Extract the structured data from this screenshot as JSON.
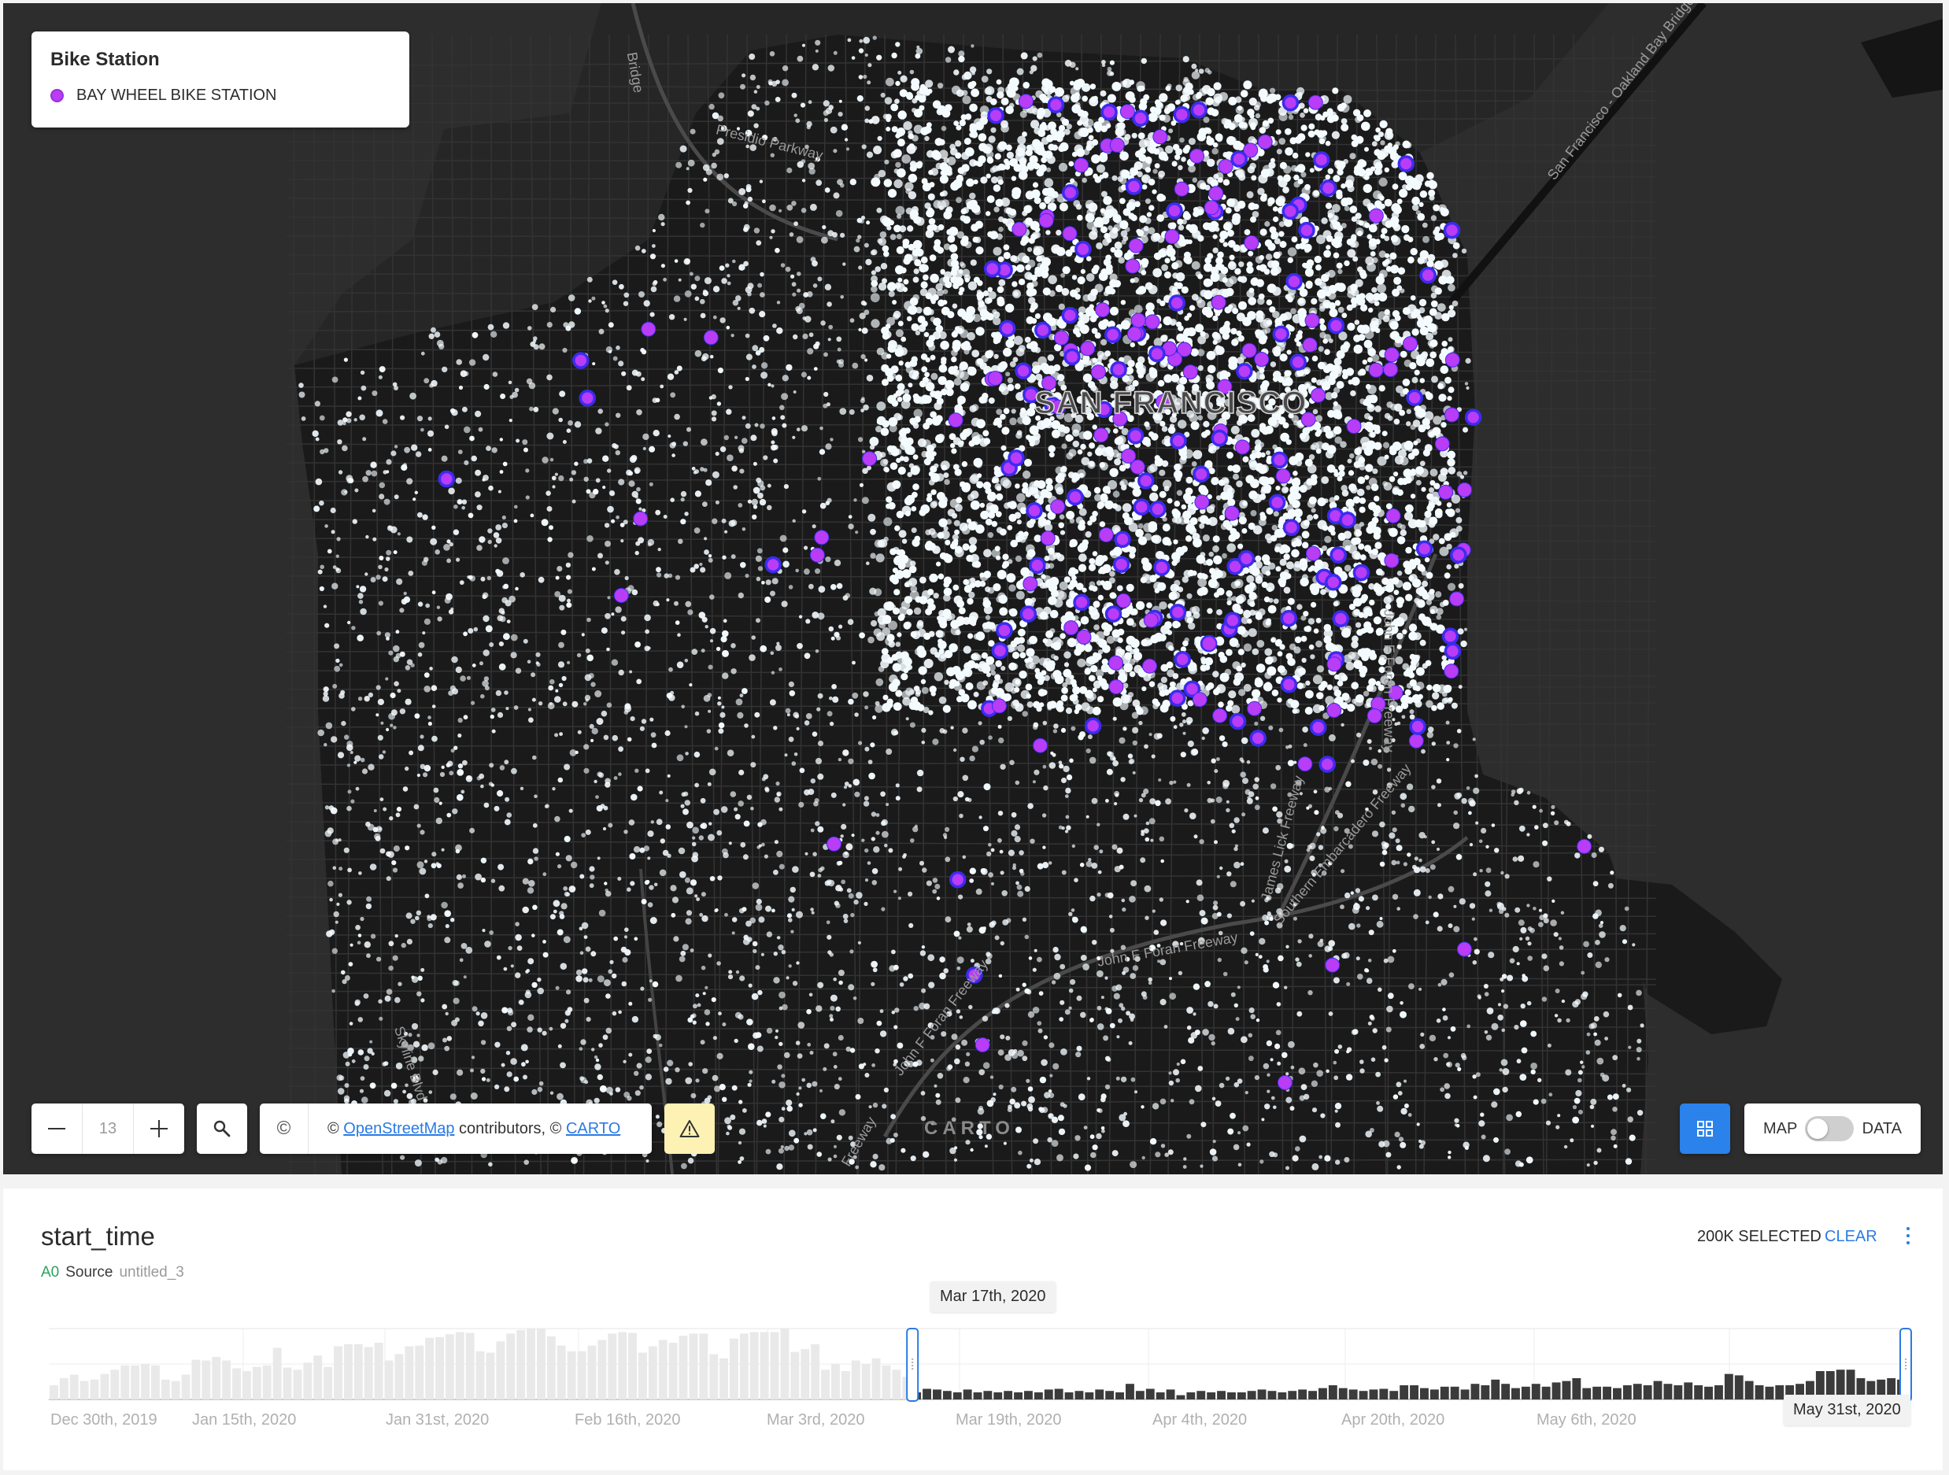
{
  "legend": {
    "title": "Bike Station",
    "item_label": "BAY WHEEL BIKE STATION",
    "item_color": "#b93cf6"
  },
  "map": {
    "city_label": "SAN FRANCISCO",
    "road_labels": [
      "Presidio Parkway",
      "San Francisco - Oakland Bay Bridge",
      "Bridge",
      "James Lick Freeway",
      "John F Foran Freeway",
      "Southern Embarcadero Freeway",
      "John F Foran Freeway",
      "Skyline Blvd",
      "John F Foran Freeway",
      "Freeway"
    ],
    "background_color": "#262626",
    "trip_point_color": "#f4fbff",
    "station_stroke_color": "#3a2cf0"
  },
  "controls": {
    "zoom_out_icon": "minus-icon",
    "zoom_level": "13",
    "zoom_in_icon": "plus-icon",
    "search_icon": "search-icon",
    "copyright_symbol": "©",
    "attribution_prefix": "© ",
    "attribution_link_1": "OpenStreetMap",
    "attribution_middle": " contributors, © ",
    "attribution_link_2": "CARTO",
    "warning_icon": "warning-icon",
    "logo_text": "CARTO",
    "layers_icon": "layers-icon",
    "view_map_label": "MAP",
    "view_data_label": "DATA"
  },
  "widget": {
    "title": "start_time",
    "source_id": "A0",
    "source_label": "Source",
    "source_name": "untitled_3",
    "selected_text": "200K SELECTED",
    "clear_label": "CLEAR",
    "more_icon": "more-vertical-icon",
    "range_start_label": "Mar 17th, 2020",
    "range_end_label": "May 31st, 2020"
  },
  "chart_data": {
    "type": "bar",
    "title": "start_time",
    "x_tick_labels": [
      "Dec 30th, 2019",
      "Jan 15th, 2020",
      "Jan 31st, 2020",
      "Feb 16th, 2020",
      "Mar 3rd, 2020",
      "Mar 19th, 2020",
      "Apr 4th, 2020",
      "Apr 20th, 2020",
      "May 6th, 2020"
    ],
    "selected_range": [
      "Mar 17th, 2020",
      "May 31st, 2020"
    ],
    "selected_color": "#3b3b3b",
    "unselected_color": "#e9e9e9",
    "values_relative": [
      0.2,
      0.3,
      0.35,
      0.26,
      0.28,
      0.36,
      0.42,
      0.48,
      0.48,
      0.5,
      0.48,
      0.28,
      0.26,
      0.35,
      0.56,
      0.55,
      0.6,
      0.55,
      0.44,
      0.4,
      0.46,
      0.48,
      0.73,
      0.45,
      0.42,
      0.52,
      0.62,
      0.46,
      0.75,
      0.78,
      0.78,
      0.74,
      0.8,
      0.55,
      0.64,
      0.75,
      0.76,
      0.87,
      0.88,
      0.92,
      0.95,
      0.94,
      0.68,
      0.66,
      0.82,
      0.93,
      0.98,
      1.0,
      1.0,
      0.89,
      0.76,
      0.68,
      0.68,
      0.76,
      0.84,
      0.93,
      0.95,
      0.94,
      0.66,
      0.75,
      0.84,
      0.8,
      0.9,
      0.93,
      0.93,
      0.64,
      0.58,
      0.86,
      0.93,
      0.95,
      0.95,
      0.95,
      1.0,
      0.67,
      0.71,
      0.78,
      0.42,
      0.5,
      0.4,
      0.55,
      0.5,
      0.58,
      0.48,
      0.42,
      0.32,
      0.1,
      0.15,
      0.14,
      0.12,
      0.1,
      0.14,
      0.1,
      0.12,
      0.1,
      0.12,
      0.1,
      0.12,
      0.1,
      0.14,
      0.15,
      0.1,
      0.12,
      0.1,
      0.14,
      0.12,
      0.1,
      0.22,
      0.12,
      0.15,
      0.1,
      0.14,
      0.06,
      0.1,
      0.12,
      0.1,
      0.12,
      0.1,
      0.1,
      0.12,
      0.14,
      0.12,
      0.1,
      0.12,
      0.14,
      0.12,
      0.16,
      0.2,
      0.16,
      0.14,
      0.12,
      0.14,
      0.15,
      0.12,
      0.2,
      0.2,
      0.16,
      0.14,
      0.18,
      0.18,
      0.14,
      0.22,
      0.2,
      0.28,
      0.22,
      0.16,
      0.18,
      0.22,
      0.18,
      0.24,
      0.26,
      0.3,
      0.16,
      0.18,
      0.18,
      0.16,
      0.2,
      0.22,
      0.2,
      0.26,
      0.22,
      0.2,
      0.24,
      0.2,
      0.18,
      0.2,
      0.36,
      0.34,
      0.26,
      0.2,
      0.18,
      0.2,
      0.2,
      0.22,
      0.26,
      0.4,
      0.4,
      0.42,
      0.42,
      0.3,
      0.26,
      0.28,
      0.3,
      0.28
    ]
  }
}
